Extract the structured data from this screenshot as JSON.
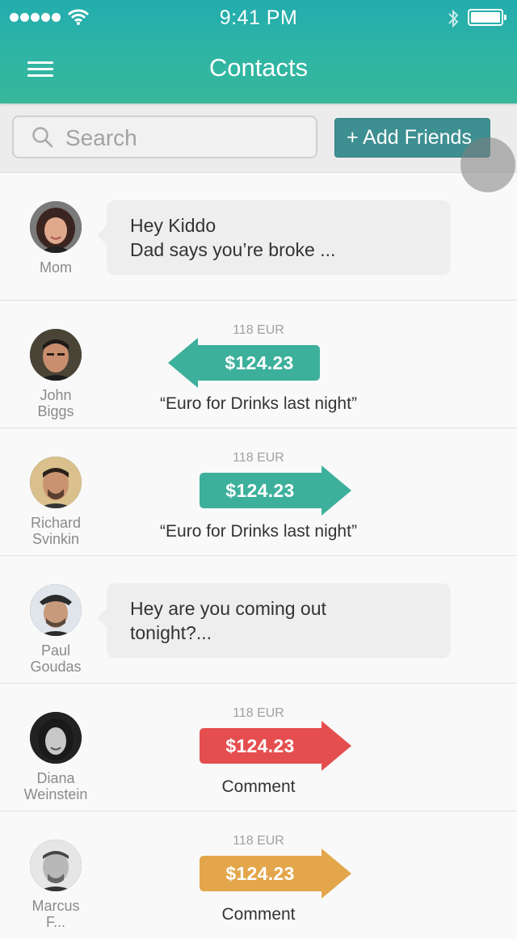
{
  "status_bar": {
    "time": "9:41 PM"
  },
  "header": {
    "title": "Contacts"
  },
  "search": {
    "placeholder": "Search",
    "value": ""
  },
  "add_friends_label": "+ Add Friends",
  "colors": {
    "teal": "#3db09c",
    "red": "#e54e4f",
    "orange": "#e3a64b"
  },
  "contacts": [
    {
      "name": "Mom",
      "message": "Hey Kiddo\nDad says you’re broke ..."
    },
    {
      "name": "John\nBiggs",
      "note": "118 EUR",
      "amount": "$124.23",
      "caption": "“Euro for Drinks last night”",
      "direction": "left",
      "color": "teal"
    },
    {
      "name": "Richard\nSvinkin",
      "note": "118 EUR",
      "amount": "$124.23",
      "caption": "“Euro for Drinks last night”",
      "direction": "right",
      "color": "teal"
    },
    {
      "name": "Paul\nGoudas",
      "message": "Hey are you coming out\ntonight?..."
    },
    {
      "name": "Diana\nWeinstein",
      "note": "118 EUR",
      "amount": "$124.23",
      "caption": "Comment",
      "direction": "right",
      "color": "red"
    },
    {
      "name": "Marcus\nF...",
      "note": "118 EUR",
      "amount": "$124.23",
      "caption": "Comment",
      "direction": "right",
      "color": "orange"
    }
  ]
}
